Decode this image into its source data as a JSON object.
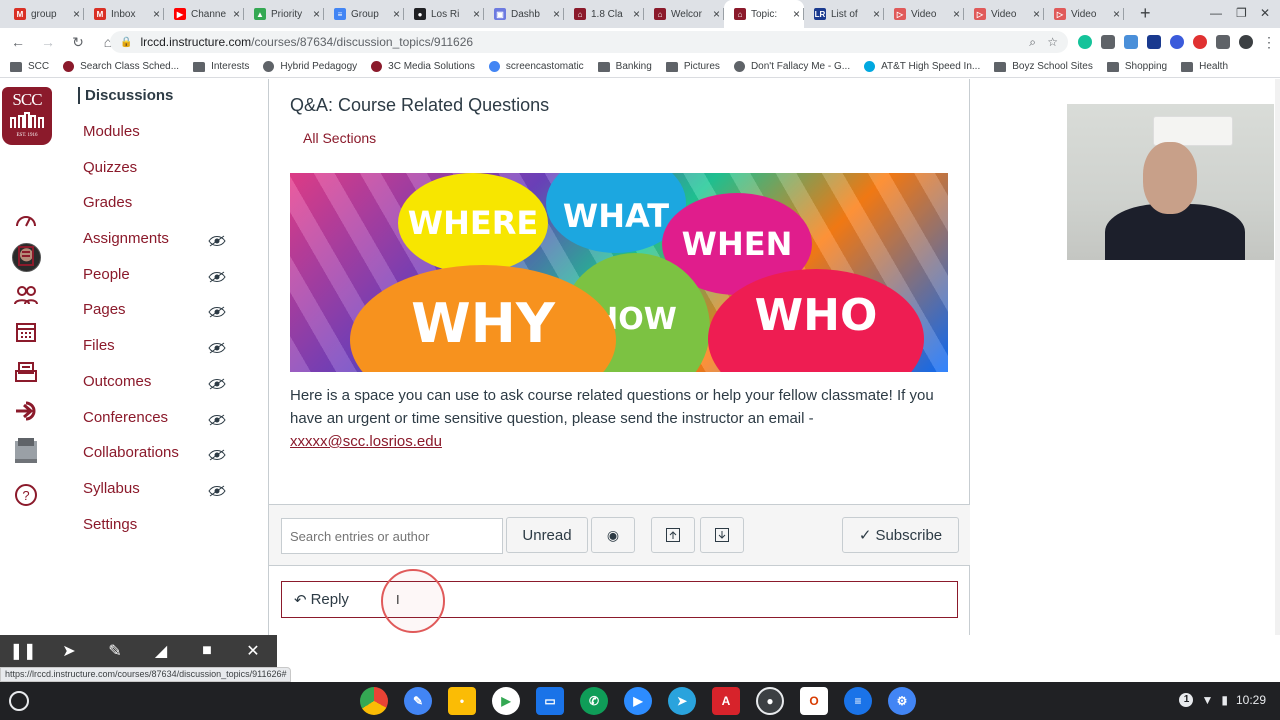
{
  "browser": {
    "tabs": [
      {
        "label": "group",
        "icon": "gmail-icon",
        "color": "#d93025",
        "glyph": "M"
      },
      {
        "label": "Inbox",
        "icon": "gmail-icon",
        "color": "#d93025",
        "glyph": "M"
      },
      {
        "label": "Channe",
        "icon": "youtube-icon",
        "color": "#ff0000",
        "glyph": "▶"
      },
      {
        "label": "Priority",
        "icon": "drive-icon",
        "color": "#34a853",
        "glyph": "▲"
      },
      {
        "label": "Group",
        "icon": "docs-icon",
        "color": "#4285f4",
        "glyph": "≡"
      },
      {
        "label": "Los Ri",
        "icon": "globe-icon",
        "color": "#202124",
        "glyph": "●"
      },
      {
        "label": "Dashb",
        "icon": "image-icon",
        "color": "#6c7ae0",
        "glyph": "▣"
      },
      {
        "label": "1.8 Cla",
        "icon": "canvas-icon",
        "color": "#8b1a2b",
        "glyph": "⌂"
      },
      {
        "label": "Welcor",
        "icon": "canvas-icon",
        "color": "#8b1a2b",
        "glyph": "⌂"
      },
      {
        "label": "Topic:",
        "icon": "canvas-icon",
        "color": "#8b1a2b",
        "glyph": "⌂",
        "active": true
      },
      {
        "label": "List of",
        "icon": "lr-icon",
        "color": "#1a3a8f",
        "glyph": "LR"
      },
      {
        "label": "Video",
        "icon": "video-icon",
        "color": "#e05a5a",
        "glyph": "▷"
      },
      {
        "label": "Video",
        "icon": "video-icon",
        "color": "#e05a5a",
        "glyph": "▷"
      },
      {
        "label": "Video",
        "icon": "video-icon",
        "color": "#e05a5a",
        "glyph": "▷"
      }
    ],
    "url_host": "lrccd.instructure.com",
    "url_path": "/courses/87634/discussion_topics/911626",
    "bookmarks": [
      {
        "label": "SCC",
        "folder": true
      },
      {
        "label": "Search Class Sched...",
        "folder": false,
        "color": "#8b1a2b"
      },
      {
        "label": "Interests",
        "folder": true
      },
      {
        "label": "Hybrid Pedagogy",
        "folder": false,
        "color": "#5f6368"
      },
      {
        "label": "3C Media Solutions",
        "folder": false,
        "color": "#8b1a2b"
      },
      {
        "label": "screencastomatic",
        "folder": false,
        "color": "#4285f4"
      },
      {
        "label": "Banking",
        "folder": true
      },
      {
        "label": "Pictures",
        "folder": true
      },
      {
        "label": "Don't Fallacy Me - G...",
        "folder": false,
        "color": "#5f6368"
      },
      {
        "label": "AT&T High Speed In...",
        "folder": false,
        "color": "#00a8e0"
      },
      {
        "label": "Boyz School Sites",
        "folder": true
      },
      {
        "label": "Shopping",
        "folder": true
      },
      {
        "label": "Health",
        "folder": true
      }
    ],
    "status_url": "https://lrccd.instructure.com/courses/87634/discussion_topics/911626#"
  },
  "logo": {
    "text": "SCC",
    "est": "EST. 1916"
  },
  "course_nav": [
    {
      "label": "Discussions",
      "active": true,
      "hidden": false
    },
    {
      "label": "Modules",
      "hidden": false
    },
    {
      "label": "Quizzes",
      "hidden": false
    },
    {
      "label": "Grades",
      "hidden": false
    },
    {
      "label": "Assignments",
      "hidden": true
    },
    {
      "label": "People",
      "hidden": true
    },
    {
      "label": "Pages",
      "hidden": true
    },
    {
      "label": "Files",
      "hidden": true
    },
    {
      "label": "Outcomes",
      "hidden": true
    },
    {
      "label": "Conferences",
      "hidden": true
    },
    {
      "label": "Collaborations",
      "hidden": true
    },
    {
      "label": "Syllabus",
      "hidden": true
    },
    {
      "label": "Settings",
      "hidden": false
    }
  ],
  "discussion": {
    "title": "Q&A: Course Related Questions",
    "sections": "All Sections",
    "banner_words": [
      "WHERE",
      "WHAT",
      "WHEN",
      "WHY",
      "HOW",
      "WHO"
    ],
    "body": "Here is a space you can use to ask course related questions or help your fellow classmate! If you have an urgent or time sensitive question, please send the instructor an email -",
    "email": "xxxxx@scc.losrios.edu",
    "search_placeholder": "Search entries or author",
    "unread_label": "Unread",
    "subscribe_label": "Subscribe",
    "reply_label": "Reply"
  },
  "system": {
    "time": "10:29",
    "notification_count": "1"
  },
  "colors": {
    "brand": "#8b1a2b",
    "text": "#2d3b45"
  }
}
